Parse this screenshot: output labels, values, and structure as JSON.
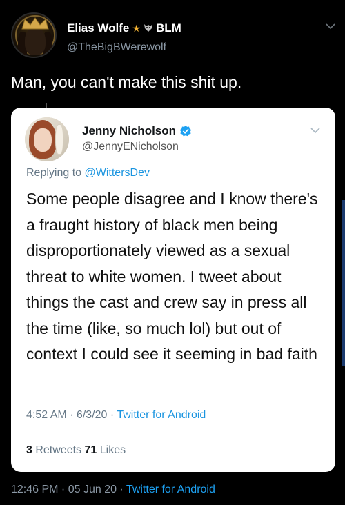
{
  "outer_tweet": {
    "display_name": "Elias Wolfe",
    "name_suffix": "BLM",
    "emoji_1": "star-emoji",
    "emoji_2": "wolf-emoji",
    "handle": "@TheBigBWerewolf",
    "text": "Man, you can't make this shit up.",
    "timestamp": "12:46 PM · 05 Jun 20 · ",
    "source": "Twitter for Android"
  },
  "quoted_tweet": {
    "display_name": "Jenny Nicholson",
    "verified": true,
    "handle": "@JennyENicholson",
    "replying_label": "Replying to ",
    "replying_to": "@WittersDev",
    "text": "Some people disagree and I know there's a fraught history of black men being disproportionately viewed as a sexual threat to white women. I tweet about things the cast and crew say in press all the time (like, so much lol) but out of context I could see it seeming in bad faith",
    "timestamp": "4:52 AM · 6/3/20 · ",
    "source": "Twitter for Android",
    "retweets_count": "3",
    "retweets_label": " Retweets ",
    "likes_count": "71",
    "likes_label": " Likes"
  },
  "colors": {
    "background": "#000000",
    "link": "#1da1f2",
    "verified": "#1da1f2",
    "muted": "#8b98a5"
  }
}
